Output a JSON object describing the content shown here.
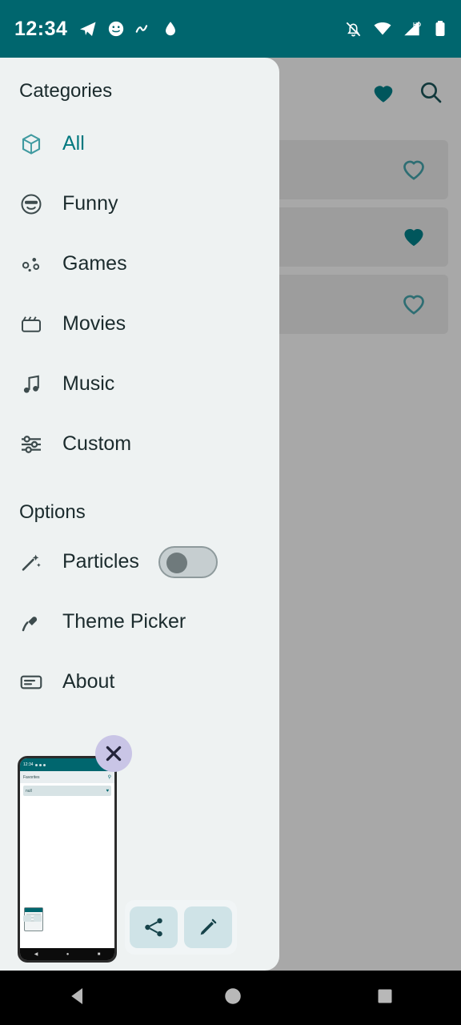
{
  "status_bar": {
    "clock": "12:34",
    "left_icons": [
      "telegram-icon",
      "smiley-icon",
      "music-icon",
      "water-drop-icon"
    ],
    "right_icons": [
      "notifications-off-icon",
      "wifi-icon",
      "mobile-data-hd-icon",
      "battery-icon"
    ],
    "background": "#00666e",
    "foreground": "#ffffff"
  },
  "background_app": {
    "title": "Favorites",
    "actions": [
      {
        "name": "favorites-filled-icon",
        "label": "Favorites"
      },
      {
        "name": "search-icon",
        "label": "Search"
      }
    ],
    "cards": [
      {
        "text": "",
        "favorite": false
      },
      {
        "text": "",
        "favorite": true
      },
      {
        "text": "",
        "favorite": false
      }
    ],
    "accent": "#00565c"
  },
  "drawer": {
    "categories_header": "Categories",
    "categories": [
      {
        "label": "All",
        "icon": "cube-icon",
        "active": true
      },
      {
        "label": "Funny",
        "icon": "smiley-sunglasses-icon",
        "active": false
      },
      {
        "label": "Games",
        "icon": "game-dice-icon",
        "active": false
      },
      {
        "label": "Movies",
        "icon": "clapperboard-icon",
        "active": false
      },
      {
        "label": "Music",
        "icon": "music-note-icon",
        "active": false
      },
      {
        "label": "Custom",
        "icon": "sliders-icon",
        "active": false
      }
    ],
    "options_header": "Options",
    "options": [
      {
        "label": "Particles",
        "icon": "sparkle-wand-icon",
        "control": "toggle",
        "value": "off"
      },
      {
        "label": "Theme Picker",
        "icon": "paint-brush-icon",
        "control": "none"
      },
      {
        "label": "About",
        "icon": "info-card-icon",
        "control": "none"
      }
    ],
    "active_color": "#00787f",
    "background": "#eef2f2"
  },
  "screenshot_preview": {
    "close_label": "✕",
    "mini": {
      "clock": "12:34",
      "app_title": "Favorites",
      "card_text": "null"
    },
    "actions": [
      {
        "name": "share-button",
        "glyph": "share-icon"
      },
      {
        "name": "edit-button",
        "glyph": "pencil-icon"
      }
    ]
  },
  "nav_bar": {
    "buttons": [
      {
        "name": "back-button",
        "glyph": "triangle-left"
      },
      {
        "name": "home-button",
        "glyph": "circle"
      },
      {
        "name": "recents-button",
        "glyph": "square"
      }
    ]
  }
}
